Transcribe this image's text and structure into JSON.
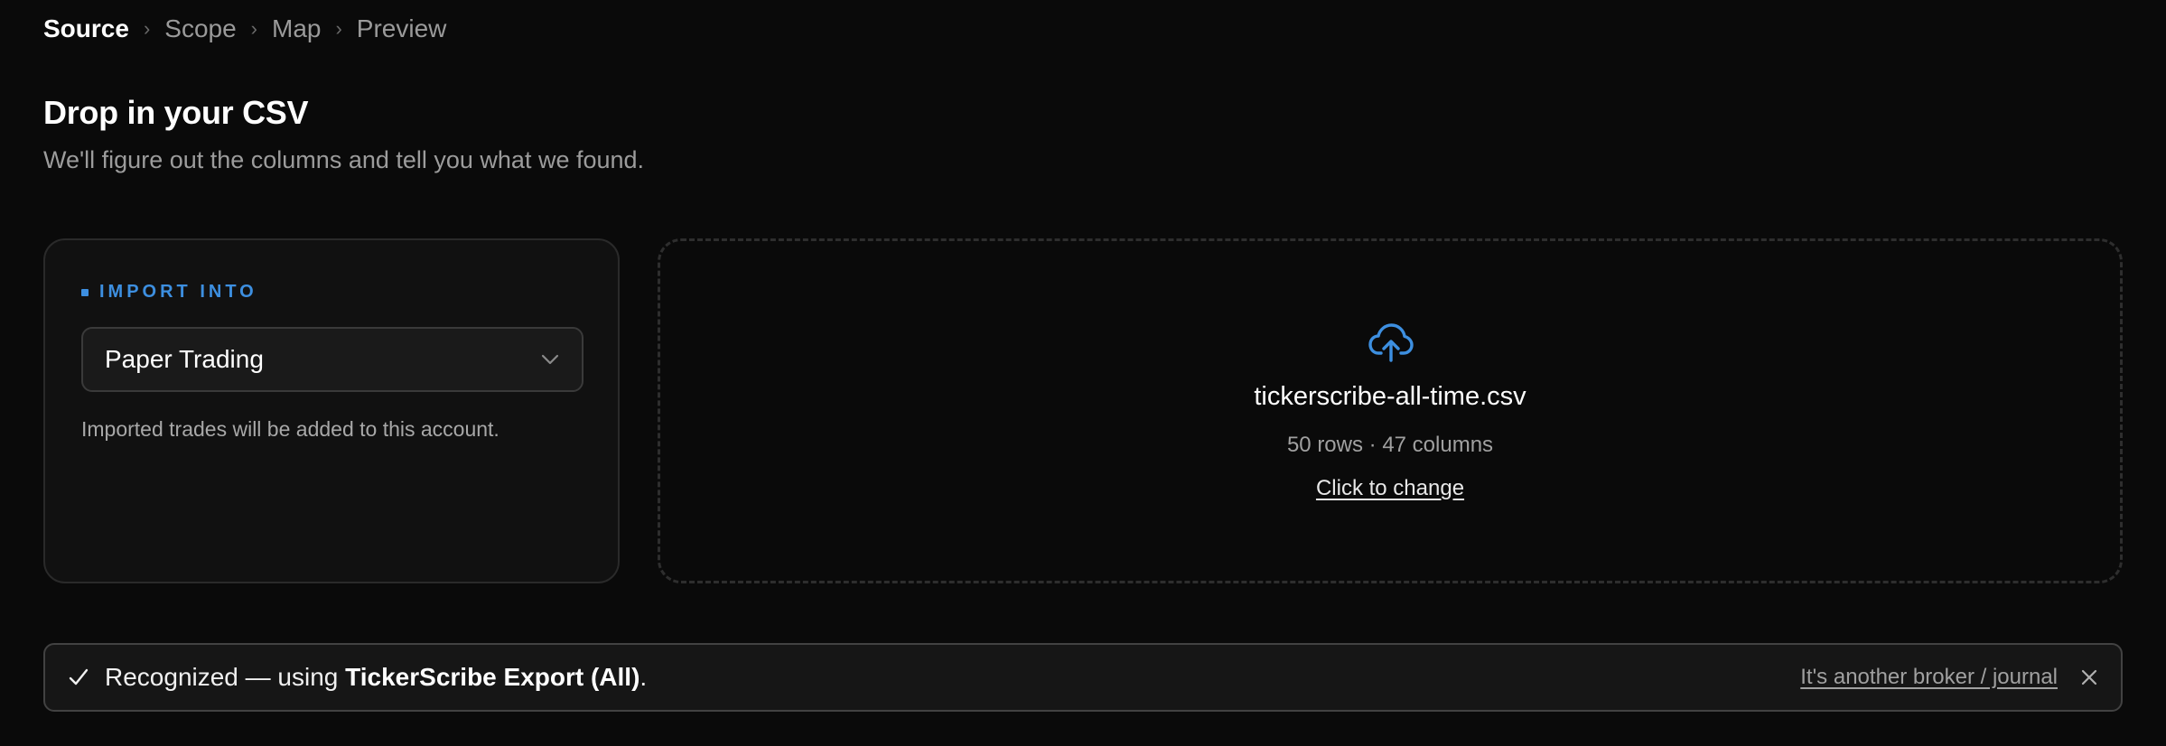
{
  "breadcrumb": {
    "steps": [
      "Source",
      "Scope",
      "Map",
      "Preview"
    ],
    "separator": "›"
  },
  "header": {
    "title": "Drop in your CSV",
    "subtitle": "We'll figure out the columns and tell you what we found."
  },
  "import_into": {
    "label": "IMPORT INTO",
    "selected_account": "Paper Trading",
    "help_text": "Imported trades will be added to this account."
  },
  "dropzone": {
    "icon": "cloud-upload-icon",
    "file_name": "tickerscribe-all-time.csv",
    "file_meta": "50 rows · 47 columns",
    "change_label": "Click to change"
  },
  "recognition": {
    "check_icon": "checkmark-icon",
    "prefix": "Recognized — using ",
    "format_name": "TickerScribe Export (All)",
    "suffix": ".",
    "other_link": "It's another broker / journal",
    "close_icon": "close-icon"
  },
  "colors": {
    "background": "#0a0a0a",
    "accent": "#3d8fe0",
    "card": "#111111",
    "muted_text": "#9c9c9c"
  }
}
